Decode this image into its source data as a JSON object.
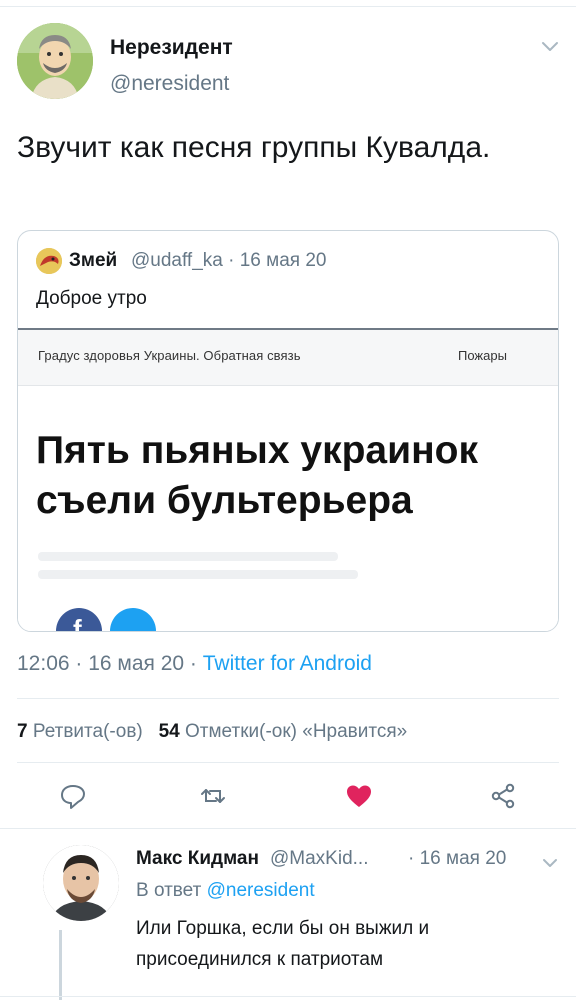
{
  "tweet": {
    "author_name": "Нерезидент",
    "author_handle": "@neresident",
    "text": "Звучит как песня группы Кувалда.",
    "timestamp": "12:06 · 16 мая 20 · ",
    "source": "Twitter for Android",
    "retweets_count": "7",
    "retweets_label": "Ретвита(-ов)",
    "likes_count": "54",
    "likes_label": "Отметки(-ок) «Нравится»",
    "liked": true
  },
  "quoted_tweet": {
    "author_name": "Змей",
    "author_handle": "@udaff_ka · 16 мая 20",
    "text": "Доброе утро",
    "image": {
      "nav_left": "Градус здоровья Украины. Обратная связь",
      "nav_right": "Пожары",
      "headline": "Пять пьяных украинок съели бультерьера"
    }
  },
  "reply": {
    "author_name": "Макс Кидман",
    "author_handle": "@MaxKid...",
    "date": "· 16 мая 20",
    "reply_to_prefix": "В ответ ",
    "reply_to_handle": "@neresident",
    "text": "Или Горшка, если бы он выжил и присоединился к патриотам"
  },
  "icons": {
    "reply": "reply-icon",
    "retweet": "retweet-icon",
    "like": "heart-icon",
    "share": "share-icon",
    "menu": "chevron-down-icon"
  },
  "colors": {
    "link": "#1da1f2",
    "secondary_text": "#657786",
    "like": "#e0245e",
    "border": "#e6ecf0"
  }
}
